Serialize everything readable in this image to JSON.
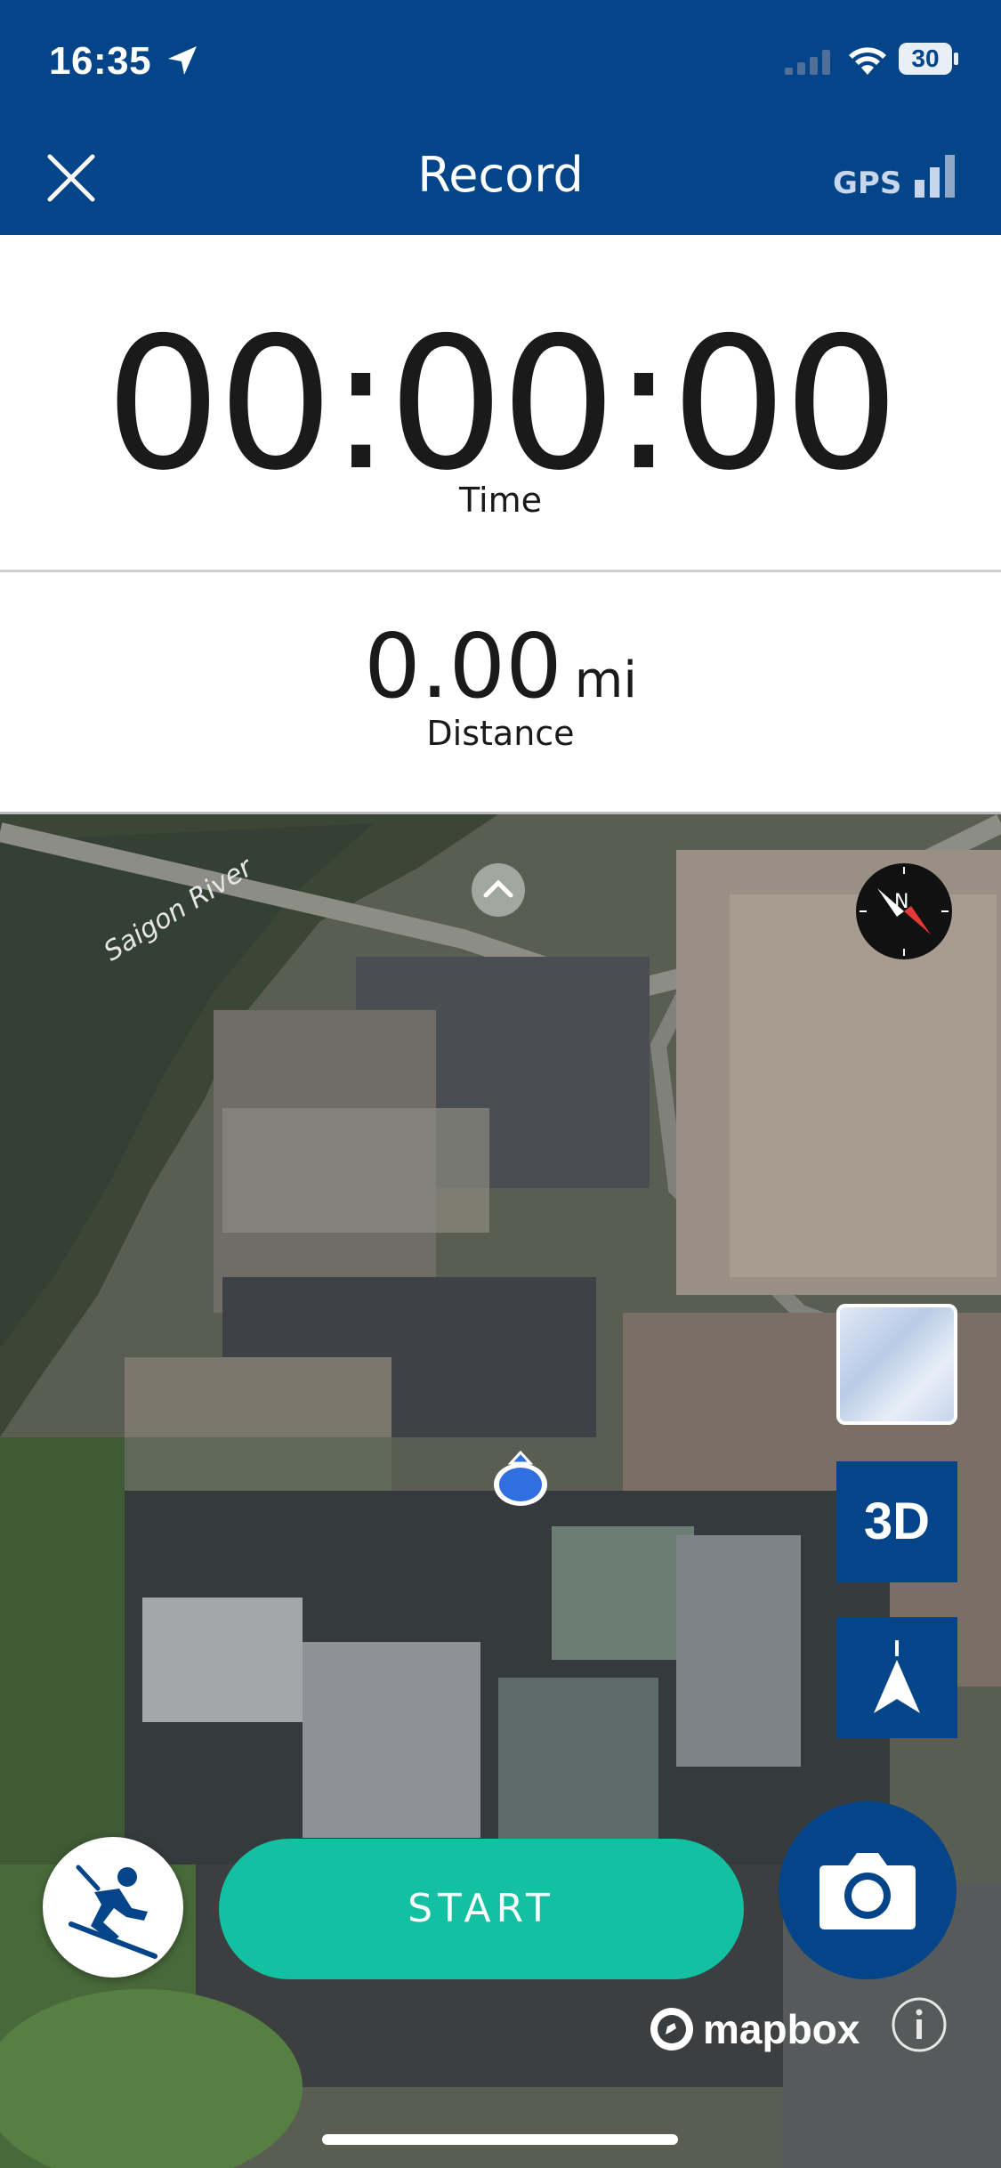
{
  "status_bar": {
    "time": "16:35",
    "battery": "30"
  },
  "header": {
    "title": "Record",
    "gps_label": "GPS"
  },
  "stats": {
    "time_value": "00:00:00",
    "time_label": "Time",
    "distance_value": "0.00",
    "distance_unit": "mi",
    "distance_label": "Distance"
  },
  "map": {
    "river_label": "Saigon River",
    "layer_3d_label": "3D",
    "attribution": "mapbox"
  },
  "controls": {
    "start_label": "START"
  },
  "colors": {
    "brand_blue": "#04458a",
    "start_green": "#14c0a2"
  },
  "icons": [
    "location-arrow-icon",
    "cellular-signal-icon",
    "wifi-icon",
    "battery-icon",
    "close-icon",
    "gps-signal-icon",
    "compass-icon",
    "chevron-up-icon",
    "user-location-icon",
    "terrain-layer-icon",
    "north-arrow-icon",
    "skier-icon",
    "camera-icon",
    "mapbox-logo-icon",
    "info-icon"
  ]
}
